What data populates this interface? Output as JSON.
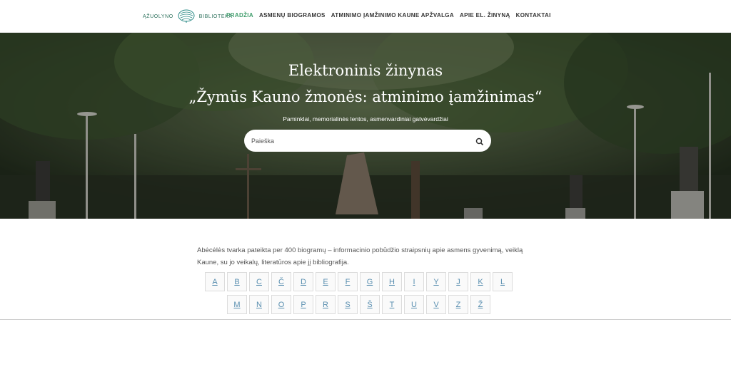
{
  "header": {
    "logo_left": "ĄŽUOLYNO",
    "logo_right": "BIBLIOTEKA",
    "nav": [
      {
        "label": "PRADŽIA",
        "active": true
      },
      {
        "label": "ASMENŲ BIOGRAMOS",
        "active": false
      },
      {
        "label": "ATMINIMO ĮAMŽINIMO KAUNE APŽVALGA",
        "active": false
      },
      {
        "label": "APIE EL. ŽINYNĄ",
        "active": false
      },
      {
        "label": "KONTAKTAI",
        "active": false
      }
    ]
  },
  "hero": {
    "title_line1": "Elektroninis žinynas",
    "title_line2": "„Žymūs Kauno žmonės: atminimo įamžinimas“",
    "subtitle": "Paminklai, memorialinės lentos, asmenvardiniai gatvėvardžiai",
    "search_placeholder": "Paieška"
  },
  "intro": "Abėcėlės tvarka pateikta per 400 biogramų – informacinio pobūdžio straipsnių apie asmens gyvenimą, veiklą Kaune, su jo veikalų, literatūros apie jį bibliografija.",
  "letters_row1": [
    "A",
    "B",
    "C",
    "Č",
    "D",
    "E",
    "F",
    "G",
    "H",
    "I",
    "Y",
    "J",
    "K",
    "L"
  ],
  "letters_row2": [
    "M",
    "N",
    "O",
    "P",
    "R",
    "S",
    "Š",
    "T",
    "U",
    "V",
    "Z",
    "Ž"
  ],
  "colors": {
    "accent": "#3f9d6b",
    "link": "#5a8fb0"
  }
}
